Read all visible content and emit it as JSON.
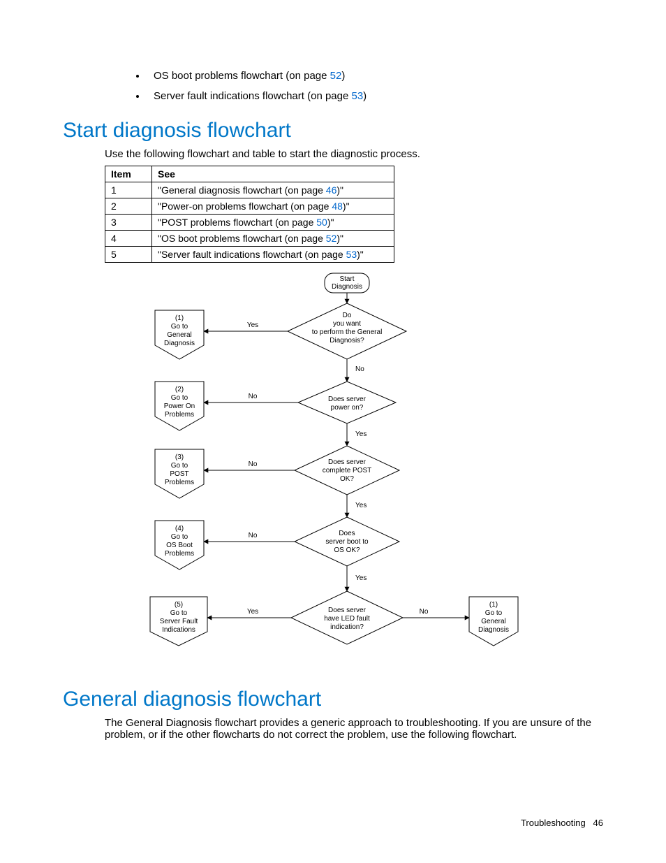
{
  "bullets": [
    {
      "prefix": "OS boot problems flowchart (on page ",
      "page": "52",
      "suffix": ")"
    },
    {
      "prefix": "Server fault indications flowchart (on page ",
      "page": "53",
      "suffix": ")"
    }
  ],
  "section1": {
    "title": "Start diagnosis flowchart",
    "intro": "Use the following flowchart and table to start the diagnostic process.",
    "table": {
      "head_item": "Item",
      "head_see": "See",
      "rows": [
        {
          "item": "1",
          "prefix": "\"General diagnosis flowchart (on page ",
          "page": "46",
          "suffix": ")\""
        },
        {
          "item": "2",
          "prefix": "\"Power-on problems flowchart (on page ",
          "page": "48",
          "suffix": ")\""
        },
        {
          "item": "3",
          "prefix": "\"POST problems flowchart (on page ",
          "page": "50",
          "suffix": ")\""
        },
        {
          "item": "4",
          "prefix": "\"OS boot problems flowchart (on page ",
          "page": "52",
          "suffix": ")\""
        },
        {
          "item": "5",
          "prefix": "\"Server fault indications flowchart (on page ",
          "page": "53",
          "suffix": ")\""
        }
      ]
    }
  },
  "flow": {
    "start_l1": "Start",
    "start_l2": "Diagnosis",
    "d1_l1": "Do",
    "d1_l2": "you want",
    "d1_l3": "to perform the General",
    "d1_l4": "Diagnosis?",
    "d2_l1": "Does server",
    "d2_l2": "power on?",
    "d3_l1": "Does server",
    "d3_l2": "complete POST",
    "d3_l3": "OK?",
    "d4_l1": "Does",
    "d4_l2": "server boot to",
    "d4_l3": "OS OK?",
    "d5_l1": "Does server",
    "d5_l2": "have LED fault",
    "d5_l3": "indication?",
    "off1_n": "(1)",
    "off1_l1": "Go to",
    "off1_l2": "General",
    "off1_l3": "Diagnosis",
    "off2_n": "(2)",
    "off2_l1": "Go to",
    "off2_l2": "Power On",
    "off2_l3": "Problems",
    "off3_n": "(3)",
    "off3_l1": "Go to",
    "off3_l2": "POST",
    "off3_l3": "Problems",
    "off4_n": "(4)",
    "off4_l1": "Go to",
    "off4_l2": "OS Boot",
    "off4_l3": "Problems",
    "off5_n": "(5)",
    "off5_l1": "Go to",
    "off5_l2": "Server Fault",
    "off5_l3": "Indications",
    "off6_n": "(1)",
    "off6_l1": "Go to",
    "off6_l2": "General",
    "off6_l3": "Diagnosis",
    "yes": "Yes",
    "no": "No"
  },
  "section2": {
    "title": "General diagnosis flowchart",
    "intro": "The General Diagnosis flowchart provides a generic approach to troubleshooting. If you are unsure of the problem, or if the other flowcharts do not correct the problem, use the following flowchart."
  },
  "footer": {
    "label": "Troubleshooting",
    "page": "46"
  }
}
